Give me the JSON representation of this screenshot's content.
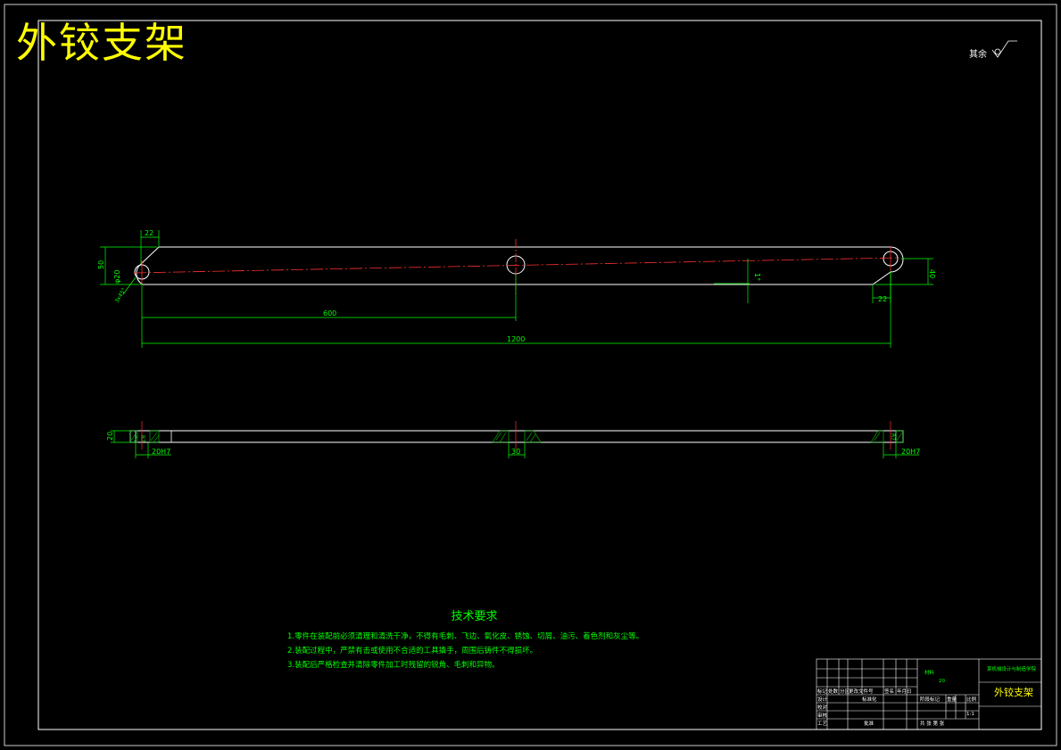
{
  "drawing": {
    "title": "外铰支架",
    "roughness_note": "其余",
    "colors": {
      "background": "#000000",
      "frame": "#ffffff",
      "dimension": "#00ff00",
      "centerline": "#ff0000",
      "title": "#ffff00"
    }
  },
  "dimensions": {
    "top_pin_offset": "22",
    "left_height": "50",
    "hole_small": "φ20",
    "hole_chamfer": "3x45°",
    "half_length": "600",
    "total_length": "1200",
    "taper": "1°",
    "right_height": "40",
    "right_offset": "22",
    "thickness": "20",
    "left_bore": "20H7",
    "mid_bore": "30",
    "right_bore": "20H7",
    "section_mark_left": "R7",
    "section_mark_right": "R7"
  },
  "technical_requirements": {
    "title": "技术要求",
    "items": [
      "1.零件在装配前必须清理和清洗干净，不得有毛刺、飞边、氧化皮、锈蚀、切屑、油污、着色剂和灰尘等。",
      "2.装配过程中，严禁有击或使用不合适的工具撬手，周围后铸件不得损坏。",
      "3.装配后严格检查并清除零件加工时残留的锐角、毛刺和异物。"
    ]
  },
  "title_block": {
    "material_label": "材料",
    "material_value": "20",
    "school": "某机械设计与制造学院",
    "part_name": "外铰支架",
    "row_labels": [
      "标记",
      "处数",
      "分区",
      "更改文件号",
      "签名",
      "年月日"
    ],
    "role_design": "设计",
    "role_check": "校对",
    "role_review": "审核",
    "role_process": "工艺",
    "role_approve": "批准",
    "standardize": "标准化",
    "stage_mark": "阶段标记",
    "weight": "重量",
    "scale": "比例",
    "scale_value": "1:1",
    "sheets": "共  张 第  张"
  }
}
